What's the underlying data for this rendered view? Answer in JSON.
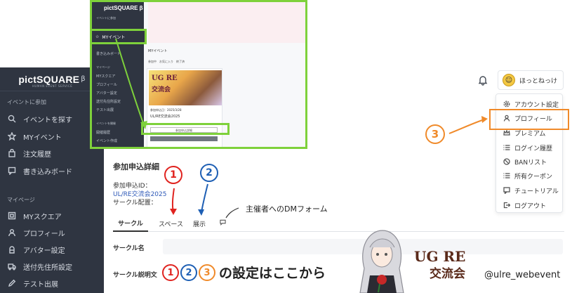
{
  "sidebar": {
    "logo": "pictSQUARE",
    "logo_suffix": "β",
    "tagline": "HUMAN EVENT SERVICE",
    "section_event": "イベントに参加",
    "items_event": [
      {
        "label": "イベントを探す",
        "icon": "search-icon"
      },
      {
        "label": "MYイベント",
        "icon": "star-icon"
      },
      {
        "label": "注文履歴",
        "icon": "bag-icon"
      },
      {
        "label": "書き込みボード",
        "icon": "message-icon"
      }
    ],
    "section_my": "マイページ",
    "items_my": [
      {
        "label": "MYスクエア",
        "icon": "square-icon"
      },
      {
        "label": "プロフィール",
        "icon": "user-icon"
      },
      {
        "label": "アバター設定",
        "icon": "avatar-icon"
      },
      {
        "label": "送付先住所設定",
        "icon": "truck-icon"
      },
      {
        "label": "テスト出展",
        "icon": "pencil-icon"
      }
    ]
  },
  "header": {
    "user_name": "ほっとねっけ"
  },
  "dropdown": {
    "items": [
      {
        "label": "アカウント設定",
        "icon": "gear-icon"
      },
      {
        "label": "プロフィール",
        "icon": "user-icon"
      },
      {
        "label": "プレミアム",
        "icon": "crown-icon"
      },
      {
        "label": "ログイン履歴",
        "icon": "list-icon"
      },
      {
        "label": "BANリスト",
        "icon": "ban-icon"
      },
      {
        "label": "所有クーポン",
        "icon": "coupon-icon"
      },
      {
        "label": "チュートリアル",
        "icon": "chat-icon"
      },
      {
        "label": "ログアウト",
        "icon": "logout-icon"
      }
    ]
  },
  "main": {
    "title": "参加申込詳細",
    "app_id_label": "参加申込ID：",
    "event_link": "UL/RE交流会2025",
    "circle_label": "サークル配置：",
    "tabs": [
      "サークル",
      "スペース",
      "展示"
    ],
    "dm_tab_icon": "chat-icon",
    "fields": [
      {
        "label": "サークル名"
      },
      {
        "label": "サークル説明文"
      }
    ]
  },
  "annotations": {
    "num1": "1",
    "num2": "2",
    "num3": "3",
    "dm_form": "主催者へのDMフォーム",
    "color_red": "#e0231f",
    "color_blue": "#1e5fb4",
    "color_orange": "#f08a2a",
    "color_green": "#7ed13b",
    "banner_circled1": "1",
    "banner_circled2": "2",
    "banner_circled3": "3",
    "banner": "の設定はここから",
    "handle": "@ulre_webevent",
    "logo_top": "UG RE",
    "logo_bottom": "交流会"
  },
  "inset": {
    "logo": "pictSQUARE β",
    "label_event": "イベントに参加",
    "my_event": "MYイベント",
    "board": "書き込みボード",
    "label_my": "マイページ",
    "items": [
      "MYスクエア",
      "プロフィール",
      "アバター設定",
      "送付先住所設定",
      "テスト出展"
    ],
    "label_host": "イベントを開催",
    "host_items": [
      "開催履歴",
      "イベント作成"
    ],
    "page_title": "MYイベント",
    "tabs": "参加中　お気に入り　終了済",
    "card_title_top": "UG RE",
    "card_title_bottom": "交流会",
    "card_date": "参加申込日：2025/3/28",
    "card_name": "UL/RE交流会2025",
    "card_btn": "参加申込詳細"
  }
}
